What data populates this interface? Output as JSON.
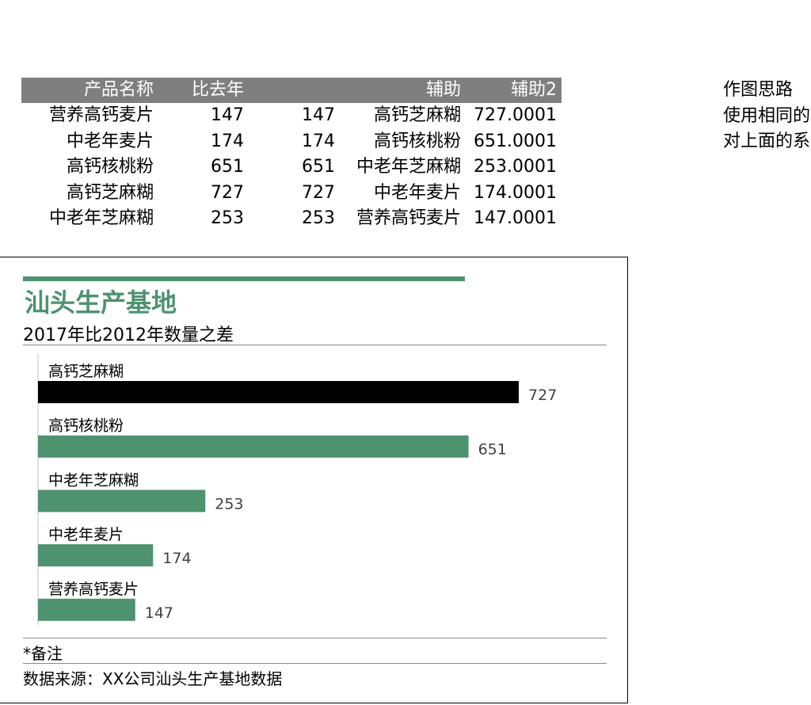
{
  "table": {
    "headers": [
      "产品名称",
      "比去年",
      "",
      "辅助",
      "辅助2"
    ],
    "rows": [
      [
        "营养高钙麦片",
        "147",
        "147",
        "高钙芝麻糊",
        "727.0001"
      ],
      [
        "中老年麦片",
        "174",
        "174",
        "高钙核桃粉",
        "651.0001"
      ],
      [
        "高钙核桃粉",
        "651",
        "651",
        "中老年芝麻糊",
        "253.0001"
      ],
      [
        "高钙芝麻糊",
        "727",
        "727",
        "中老年麦片",
        "174.0001"
      ],
      [
        "中老年芝麻糊",
        "253",
        "253",
        "营养高钙麦片",
        "147.0001"
      ]
    ]
  },
  "side_note": [
    "作图思路",
    "使用相同的",
    "对上面的系"
  ],
  "chart_data": {
    "type": "bar",
    "orientation": "horizontal",
    "title": "汕头生产基地",
    "subtitle": "2017年比2012年数量之差",
    "categories": [
      "高钙芝麻糊",
      "高钙核桃粉",
      "中老年芝麻糊",
      "中老年麦片",
      "营养高钙麦片"
    ],
    "values": [
      727,
      651,
      253,
      174,
      147
    ],
    "xlim": [
      0,
      800
    ],
    "highlight_color": "#000000",
    "bar_color": "#4e9270",
    "grid": false,
    "legend": "none",
    "footnote": "*备注",
    "source": "数据来源：XX公司汕头生产基地数据"
  }
}
